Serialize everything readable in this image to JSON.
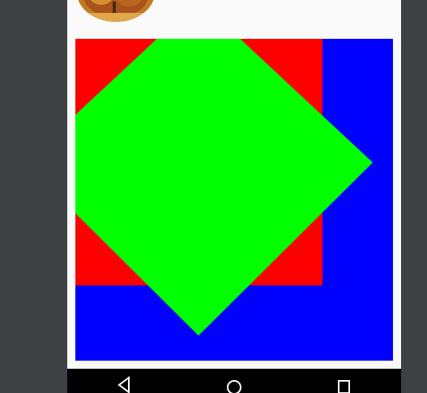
{
  "screen": {
    "background": "#3d4144",
    "content_background": "#fafafa"
  },
  "avatar": {
    "description_icon": "autumn-tree-photo"
  },
  "drawing": {
    "background_color": "#0000ff",
    "square_color": "#ff0000",
    "diamond_color": "#00ff00"
  },
  "navbar": {
    "background": "#000000",
    "buttons": [
      {
        "name": "back-button",
        "icon": "triangle-back-icon"
      },
      {
        "name": "home-button",
        "icon": "circle-home-icon"
      },
      {
        "name": "recents-button",
        "icon": "square-recents-icon"
      }
    ]
  }
}
